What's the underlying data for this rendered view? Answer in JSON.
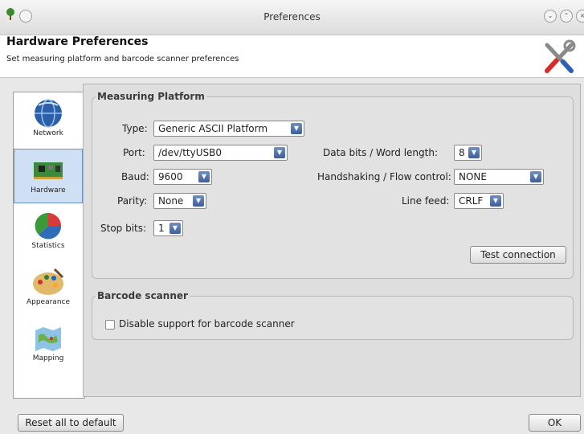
{
  "window": {
    "title": "Preferences"
  },
  "header": {
    "title": "Hardware Preferences",
    "subtitle": "Set measuring platform and barcode scanner preferences"
  },
  "nav": {
    "items": [
      {
        "label": "Network",
        "icon": "globe-icon"
      },
      {
        "label": "Hardware",
        "icon": "circuit-board-icon",
        "selected": true
      },
      {
        "label": "Statistics",
        "icon": "pie-chart-icon"
      },
      {
        "label": "Appearance",
        "icon": "palette-icon"
      },
      {
        "label": "Mapping",
        "icon": "map-icon"
      }
    ]
  },
  "measuring": {
    "legend": "Measuring Platform",
    "type_label": "Type:",
    "type_value": "Generic ASCII Platform",
    "port_label": "Port:",
    "port_value": "/dev/ttyUSB0",
    "baud_label": "Baud:",
    "baud_value": "9600",
    "parity_label": "Parity:",
    "parity_value": "None",
    "stopbits_label": "Stop bits:",
    "stopbits_value": "1",
    "databits_label": "Data bits / Word length:",
    "databits_value": "8",
    "handshake_label": "Handshaking / Flow control:",
    "handshake_value": "NONE",
    "linefeed_label": "Line feed:",
    "linefeed_value": "CRLF",
    "test_button": "Test connection"
  },
  "barcode": {
    "legend": "Barcode scanner",
    "disable_label": "Disable support for barcode scanner",
    "disable_checked": false
  },
  "footer": {
    "reset_button": "Reset all to default",
    "ok_button": "OK"
  }
}
